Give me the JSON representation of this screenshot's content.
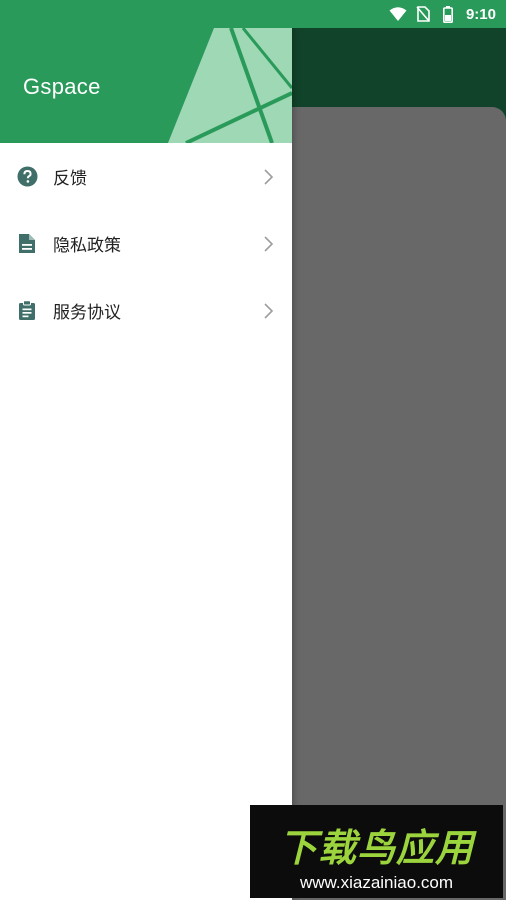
{
  "status_bar": {
    "time": "9:10",
    "icons": [
      "wifi-icon",
      "no-sim-icon",
      "battery-icon"
    ]
  },
  "drawer": {
    "app_name": "Gspace",
    "items": [
      {
        "label": "反馈",
        "icon": "help-circle-icon"
      },
      {
        "label": "隐私政策",
        "icon": "document-icon"
      },
      {
        "label": "服务协议",
        "icon": "clipboard-icon"
      }
    ]
  },
  "colors": {
    "primary": "#2a9a5a",
    "primary_dark": "#11432a",
    "icon_tint": "#3f6f68",
    "scrim": "#666666"
  },
  "watermark": {
    "title": "下载鸟应用",
    "url": "www.xiazainiao.com"
  }
}
